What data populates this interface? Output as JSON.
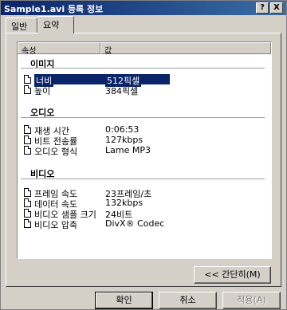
{
  "window": {
    "title": "Sample1.avi 등록 정보"
  },
  "titlebar_buttons": {
    "help": "?",
    "close": "X"
  },
  "tabs": [
    {
      "label": "일반"
    },
    {
      "label": "요약"
    }
  ],
  "listview": {
    "columns": {
      "property": "속성",
      "value": "값"
    },
    "groups": [
      {
        "title": "이미지",
        "rows": [
          {
            "prop": "너비",
            "value": "512픽셀",
            "selected": true
          },
          {
            "prop": "높이",
            "value": "384픽셀"
          }
        ]
      },
      {
        "title": "오디오",
        "rows": [
          {
            "prop": "재생 시간",
            "value": "0:06:53"
          },
          {
            "prop": "비트 전송률",
            "value": "127kbps"
          },
          {
            "prop": "오디오 형식",
            "value": "Lame MP3"
          }
        ]
      },
      {
        "title": "비디오",
        "rows": [
          {
            "prop": "프레임 속도",
            "value": "23프레임/초"
          },
          {
            "prop": "데이터 속도",
            "value": "132kbps"
          },
          {
            "prop": "비디오 샘플 크기",
            "value": "24비트"
          },
          {
            "prop": "비디오 압축",
            "value": "DivX® Codec"
          }
        ]
      }
    ]
  },
  "buttons": {
    "simple": "<< 간단히(M)",
    "ok": "확인",
    "cancel": "취소",
    "apply": "적용(A)"
  }
}
